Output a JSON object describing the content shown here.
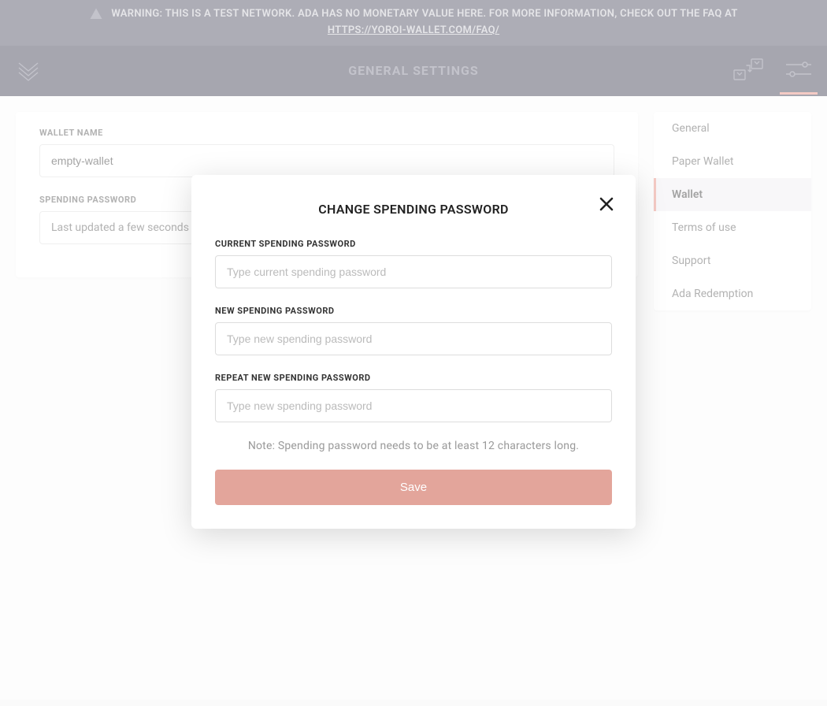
{
  "banner": {
    "text": "WARNING: THIS IS A TEST NETWORK. ADA HAS NO MONETARY VALUE HERE. FOR MORE INFORMATION, CHECK OUT THE FAQ AT",
    "faq_url": "HTTPS://YOROI-WALLET.COM/FAQ/"
  },
  "header": {
    "title": "GENERAL SETTINGS"
  },
  "content": {
    "wallet_name": {
      "label": "WALLET NAME",
      "value": "empty-wallet"
    },
    "spending_password": {
      "label": "SPENDING PASSWORD",
      "status": "Last updated a few seconds ago"
    }
  },
  "sidenav": {
    "items": [
      {
        "label": "General",
        "key": "general",
        "active": false
      },
      {
        "label": "Paper Wallet",
        "key": "paper-wallet",
        "active": false
      },
      {
        "label": "Wallet",
        "key": "wallet",
        "active": true
      },
      {
        "label": "Terms of use",
        "key": "terms-of-use",
        "active": false
      },
      {
        "label": "Support",
        "key": "support",
        "active": false
      },
      {
        "label": "Ada Redemption",
        "key": "ada-redemption",
        "active": false
      }
    ]
  },
  "modal": {
    "title": "CHANGE SPENDING PASSWORD",
    "current": {
      "label": "CURRENT SPENDING PASSWORD",
      "placeholder": "Type current spending password"
    },
    "new": {
      "label": "NEW SPENDING PASSWORD",
      "placeholder": "Type new spending password"
    },
    "repeat": {
      "label": "REPEAT NEW SPENDING PASSWORD",
      "placeholder": "Type new spending password"
    },
    "note": "Note: Spending password needs to be at least 12 characters long.",
    "save_label": "Save"
  },
  "icons": {
    "warning": "warning-triangle-icon",
    "logo": "yoroi-logo-icon",
    "wallets": "wallets-icon",
    "settings": "settings-sliders-icon",
    "close": "close-icon"
  }
}
